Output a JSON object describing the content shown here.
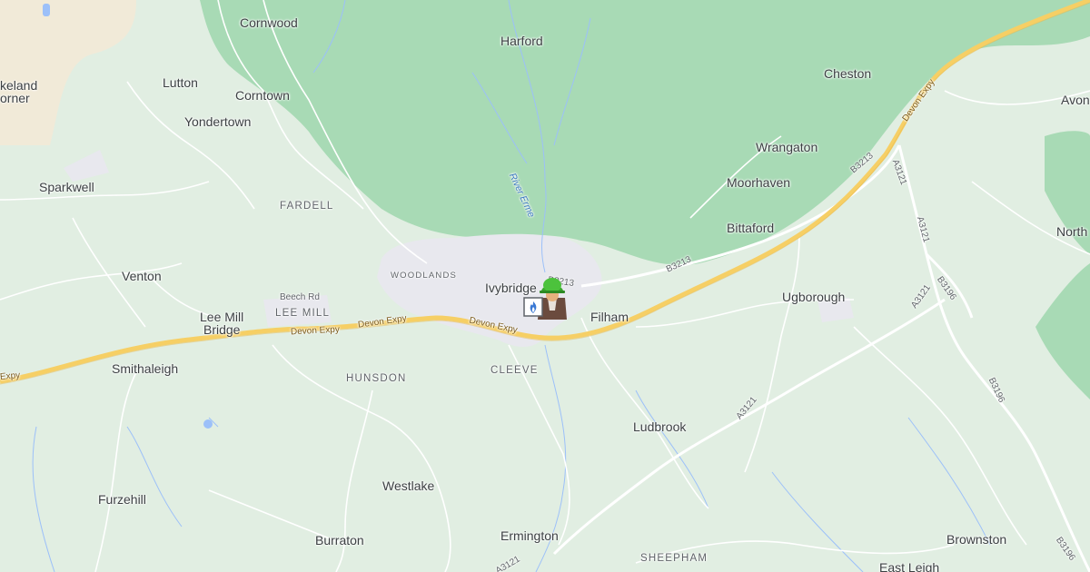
{
  "map": {
    "colors": {
      "land": "#e1eee2",
      "park": "#a8dab5",
      "urban": "#e8e8ee",
      "motorway": "#f6cf65",
      "road": "#ffffff",
      "water": "#9cc0f9"
    },
    "places": {
      "cornwood": "Cornwood",
      "harford": "Harford",
      "cheston": "Cheston",
      "avon": "Avon",
      "lutton": "Lutton",
      "cornwood_town": "Corntown",
      "yondertown": "Yondertown",
      "sparkwell": "Sparkwell",
      "wrangaton": "Wrangaton",
      "moorhaven": "Moorhaven",
      "bittaford": "Bittaford",
      "venton": "Venton",
      "north": "North",
      "ivybridge": "Ivybridge",
      "ugborough": "Ugborough",
      "lee_mill_bridge_1": "Lee Mill",
      "lee_mill_bridge_2": "Bridge",
      "filham": "Filham",
      "smithaleigh": "Smithaleigh",
      "ludbrook": "Ludbrook",
      "westlake": "Westlake",
      "furzehill": "Furzehill",
      "burraton": "Burraton",
      "ermington": "Ermington",
      "brownston": "Brownston",
      "east_leigh": "East Leigh",
      "lakeland_1": "keland",
      "lakeland_2": "orner"
    },
    "districts": {
      "fardell": "FARDELL",
      "woodlands": "WOODLANDS",
      "lee_mill": "LEE MILL",
      "hunsdon": "HUNSDON",
      "cleeve": "CLEEVE",
      "sheepham": "SHEEPHAM"
    },
    "roads": {
      "devon_expy_1": "Devon Expy",
      "devon_expy_2": "Devon Expy",
      "devon_expy_3": "Devon Expy",
      "devon_expy_4": "Devon Expy",
      "devon_expy_edge": "Expy",
      "b3213_1": "B3213",
      "b3213_2": "B3213",
      "b3213_3": "B3213",
      "a3121_1": "A3121",
      "a3121_2": "A3121",
      "a3121_3": "A3121",
      "a3121_4": "A3121",
      "a3121_5": "A3121",
      "b3196_1": "B3196",
      "b3196_2": "B3196",
      "b3196_3": "B3196",
      "beech_rd": "Beech Rd",
      "river_erme": "River Erme"
    },
    "marker": {
      "icon": "worker-with-hard-hat-icon",
      "badge_icon": "gas-flame-icon"
    }
  }
}
